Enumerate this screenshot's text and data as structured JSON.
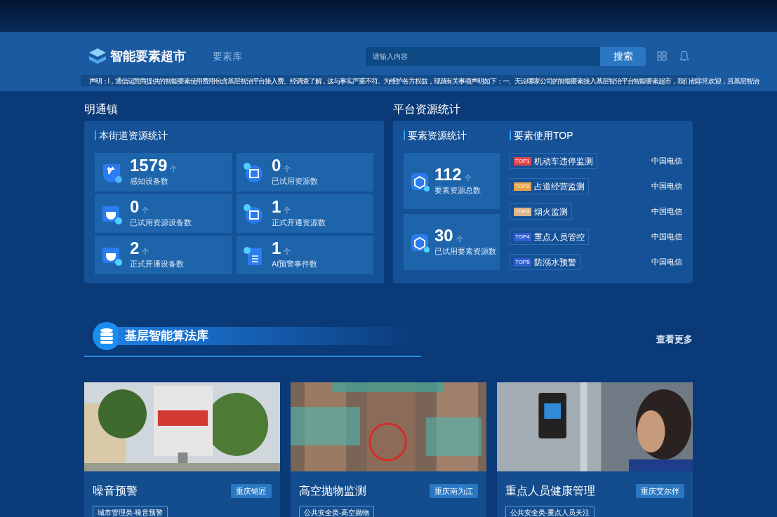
{
  "header": {
    "logo": "智能要素超市",
    "nav": [
      {
        "label": "要素库",
        "selected": false
      }
    ],
    "search": {
      "placeholder": "请输入内容",
      "button": "搜索"
    },
    "notice": "声明：l，通信运营商提供的智能要素使用费用包含基层智治平台接入费。经调查了解，这与事实严重不符。为维护各方权益，现就有关事项声明如下：一、无论哪家公司的智能要素接入基层智治平台智能要素超市，我们都非常欢迎，且基层智治"
  },
  "street": {
    "title": "明通镇",
    "panel_title": "本街道资源统计",
    "stats": [
      {
        "value": "1579",
        "unit": "个",
        "label": "感知设备数",
        "kind": "sensor"
      },
      {
        "value": "0",
        "unit": "个",
        "label": "已试用资源数",
        "kind": "screen"
      },
      {
        "value": "0",
        "unit": "个",
        "label": "已试用资源设备数",
        "kind": "camera"
      },
      {
        "value": "1",
        "unit": "个",
        "label": "正式开通资源数",
        "kind": "screen"
      },
      {
        "value": "2",
        "unit": "个",
        "label": "正式开通设备数",
        "kind": "camera"
      },
      {
        "value": "1",
        "unit": "个",
        "label": "AI预警事件数",
        "kind": "doc"
      }
    ]
  },
  "platform": {
    "title": "平台资源统计",
    "stats_title": "要素资源统计",
    "stats": [
      {
        "value": "112",
        "unit": "个",
        "label": "要素资源总数"
      },
      {
        "value": "30",
        "unit": "个",
        "label": "已试用要素资源数"
      }
    ],
    "top_title": "要素使用TOP",
    "top": [
      {
        "rank": "TOP1",
        "name": "机动车违停监测",
        "vendor": "中国电信",
        "color": "#e0464e"
      },
      {
        "rank": "TOP2",
        "name": "占道经营监测",
        "vendor": "中国电信",
        "color": "#e8a24a"
      },
      {
        "rank": "TOP3",
        "name": "烟火监测",
        "vendor": "中国电信",
        "color": "#d9b48a"
      },
      {
        "rank": "TOP4",
        "name": "重点人员管控",
        "vendor": "中国电信",
        "color": "#2f5fd0"
      },
      {
        "rank": "TOP5",
        "name": "防溺水预警",
        "vendor": "中国电信",
        "color": "#2f5fd0"
      }
    ]
  },
  "algorithms": {
    "title": "基层智能算法库",
    "more": "查看更多",
    "cards": [
      {
        "kind": "picture",
        "title": "噪音预警",
        "vendor": "重庆铭匠",
        "tag": "城市管理类-噪音预警"
      },
      {
        "kind": "picture",
        "title": "高空抛物监测",
        "vendor": "重庆南为江",
        "tag": "公共安全类-高空抛物"
      },
      {
        "kind": "picture",
        "title": "重点人员健康管理",
        "vendor": "重庆艾尔伴",
        "tag": "公共安全类-重点人员关注"
      }
    ]
  }
}
